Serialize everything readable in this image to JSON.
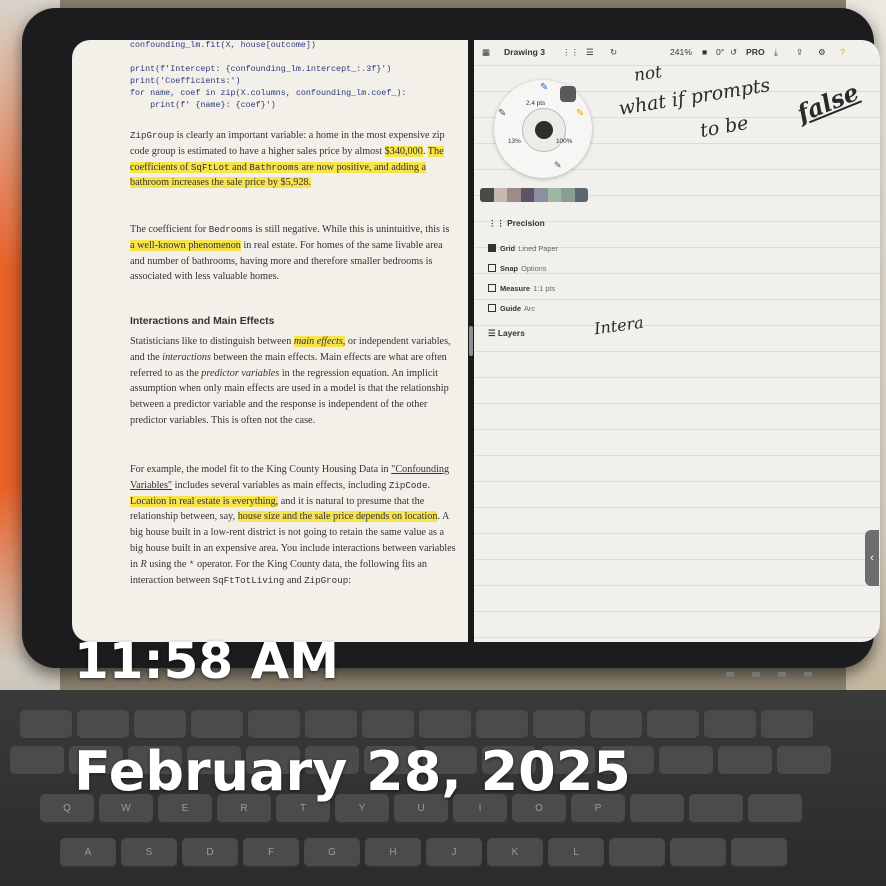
{
  "reading_pane": {
    "code_lines": [
      "confounding_lm.fit(X, house[outcome])",
      "",
      "print(f'Intercept: {confounding_lm.intercept_:.3f}')",
      "print('Coefficients:')",
      "for name, coef in zip(X.columns, confounding_lm.coef_):",
      "    print(f' {name}: {coef}')"
    ],
    "p1": {
      "a_mono": "ZipGroup",
      "b": " is clearly an important variable: a home in the most expensive zip code group is estimated to have a higher sales price by almost ",
      "c_hl": "$340,000",
      "d": ". ",
      "e_hl": "The coefficients of ",
      "f_hl_mono": "SqFtLot",
      "g_hl": " and ",
      "h_hl_mono": "Bathrooms",
      "i_hl": " are now positive, and adding a bathroom increases the sale price by $5,928."
    },
    "p2": {
      "a": "The coefficient for ",
      "b_mono": "Bedrooms",
      "c": " is still negative. While this is unintuitive, this is ",
      "d_hl": "a well-known phenomenon",
      "e": " in real estate. For homes of the same livable area and number of bathrooms, having more and therefore smaller bedrooms is associated with less valuable homes."
    },
    "heading": "Interactions and Main Effects",
    "p3": {
      "a": "Statisticians like to distinguish between ",
      "b_hl_em": "main effects,",
      "c": " or independent variables, and the ",
      "d_em": "interactions",
      "e": " between the main effects. Main effects are what are often referred to as the ",
      "f_em": "predictor variables",
      "g": " in the regression equation. An implicit assumption when only main effects are used in a model is that the relationship between a predictor variable and the response is independent of the other predictor variables. This is often not the case."
    },
    "p4": {
      "a": "For example, the model fit to the King County Housing Data in ",
      "b_link": "\"Confounding Variables\"",
      "c": " includes several variables as main effects, including ",
      "d_mono": "ZipCode",
      "e": ". ",
      "f_hl": "Location in real estate is everything,",
      "g": " and it is natural to presume that the relationship between, say, ",
      "h_hl": "house size and the sale price depends on location",
      "i": ". A big house built in a low-rent district is not going to retain the same value as a big house built in an expensive area. You include interactions between variables in ",
      "j_em": "R",
      "k": " using the ",
      "l_mono": "*",
      "m": " operator. For the King County data, the following fits an interaction between ",
      "n_mono": "SqFtTotLiving",
      "o": " and ",
      "p_mono": "ZipGroup",
      "q": ":"
    }
  },
  "drawing_app": {
    "document_title": "Drawing 3",
    "zoom": "241%",
    "rotation": "0°",
    "pro_label": "PRO",
    "brush_size": "2.4 pts",
    "opacity_left": "13%",
    "opacity_right": "100%",
    "palette": [
      "#4a4a4a",
      "#c9b8b0",
      "#9c8b8a",
      "#5b5566",
      "#8c8fa1",
      "#9fb8a6",
      "#8a9d91",
      "#5c6672"
    ],
    "precision_title": "Precision",
    "rows": [
      {
        "label": "Grid",
        "sub": "Lined Paper",
        "on": true
      },
      {
        "label": "Snap",
        "sub": "Options",
        "on": false
      },
      {
        "label": "Measure",
        "sub": "1:1 pts",
        "on": false
      },
      {
        "label": "Guide",
        "sub": "Arc",
        "on": false
      }
    ],
    "layers_title": "Layers",
    "handwriting": {
      "line1": "not",
      "line2": "what if prompts",
      "line3": "to be",
      "line4": "false",
      "line5": "Intera"
    }
  },
  "overlay": {
    "time": "11:58 AM",
    "date": "February 28, 2025"
  },
  "keyboard": {
    "row_top": [
      "",
      "",
      "",
      "",
      "",
      "",
      "",
      "",
      "",
      "",
      "",
      "",
      "",
      ""
    ],
    "row2": [
      "",
      "",
      "",
      "",
      "",
      "",
      "",
      "",
      "",
      "",
      "",
      "",
      "",
      ""
    ],
    "row3": [
      "Q",
      "W",
      "E",
      "R",
      "T",
      "Y",
      "U",
      "I",
      "O",
      "P",
      "",
      "",
      ""
    ],
    "row4": [
      "A",
      "S",
      "D",
      "F",
      "G",
      "H",
      "J",
      "K",
      "L",
      "",
      "",
      ""
    ]
  }
}
